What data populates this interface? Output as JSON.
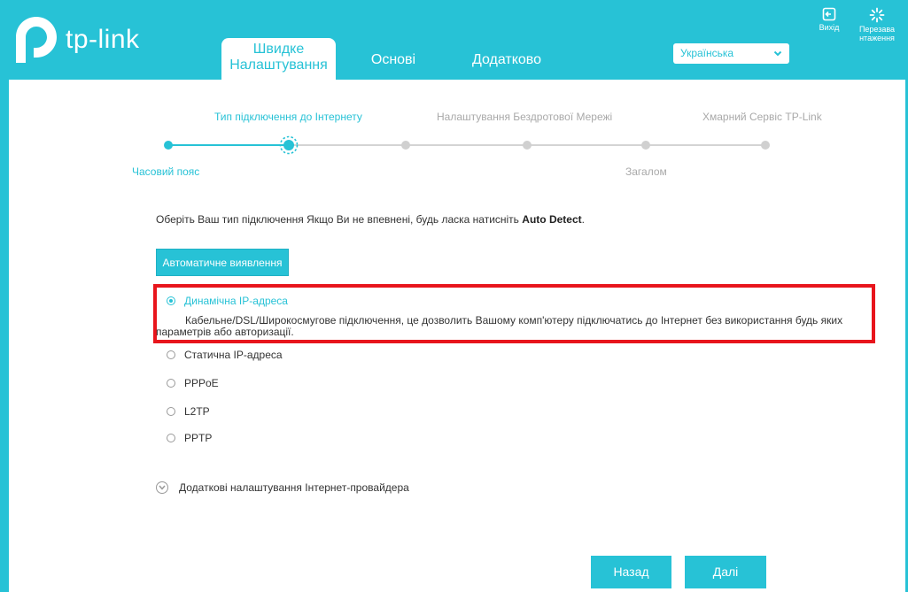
{
  "brand": {
    "logo_text": "tp-link"
  },
  "nav": {
    "tabs": [
      {
        "label_line1": "Швидке",
        "label_line2": "Налаштування",
        "active": true
      },
      {
        "label": "Основі"
      },
      {
        "label": "Додатково"
      }
    ]
  },
  "header": {
    "language": "Українська",
    "exit_label": "Вихід",
    "reboot_label_line1": "Перезава",
    "reboot_label_line2": "нтаження"
  },
  "wizard": {
    "steps_top": [
      "Тип підключення до Інтернету",
      "Налаштування Бездротової Мережі",
      "Хмарний Сервіс TP-Link"
    ],
    "steps_bottom": [
      "Часовий пояс",
      "Загалом"
    ]
  },
  "content": {
    "intro_text": "Оберіть Ваш тип підключення Якщо Ви не впевнені, будь ласка натисніть ",
    "intro_bold": "Auto Detect",
    "intro_end": ".",
    "auto_detect_button": "Автоматичне виявлення",
    "options": [
      {
        "label": "Динамічна IP-адреса",
        "selected": true
      },
      {
        "label": "Статична IP-адреса"
      },
      {
        "label": "PPPoE"
      },
      {
        "label": "L2TP"
      },
      {
        "label": "PPTP"
      }
    ],
    "dynamic_description": "Кабельне/DSL/Широкосмугове підключення, це дозволить Вашому комп'ютеру підключатись до Інтернет без використання будь яких параметрів або авторизації.",
    "isp_settings": "Додаткові налаштування Інтернет-провайдера"
  },
  "footer": {
    "back_button": "Назад",
    "next_button": "Далі"
  },
  "colors": {
    "accent": "#27c2d6",
    "highlight_border": "#e8151c"
  }
}
